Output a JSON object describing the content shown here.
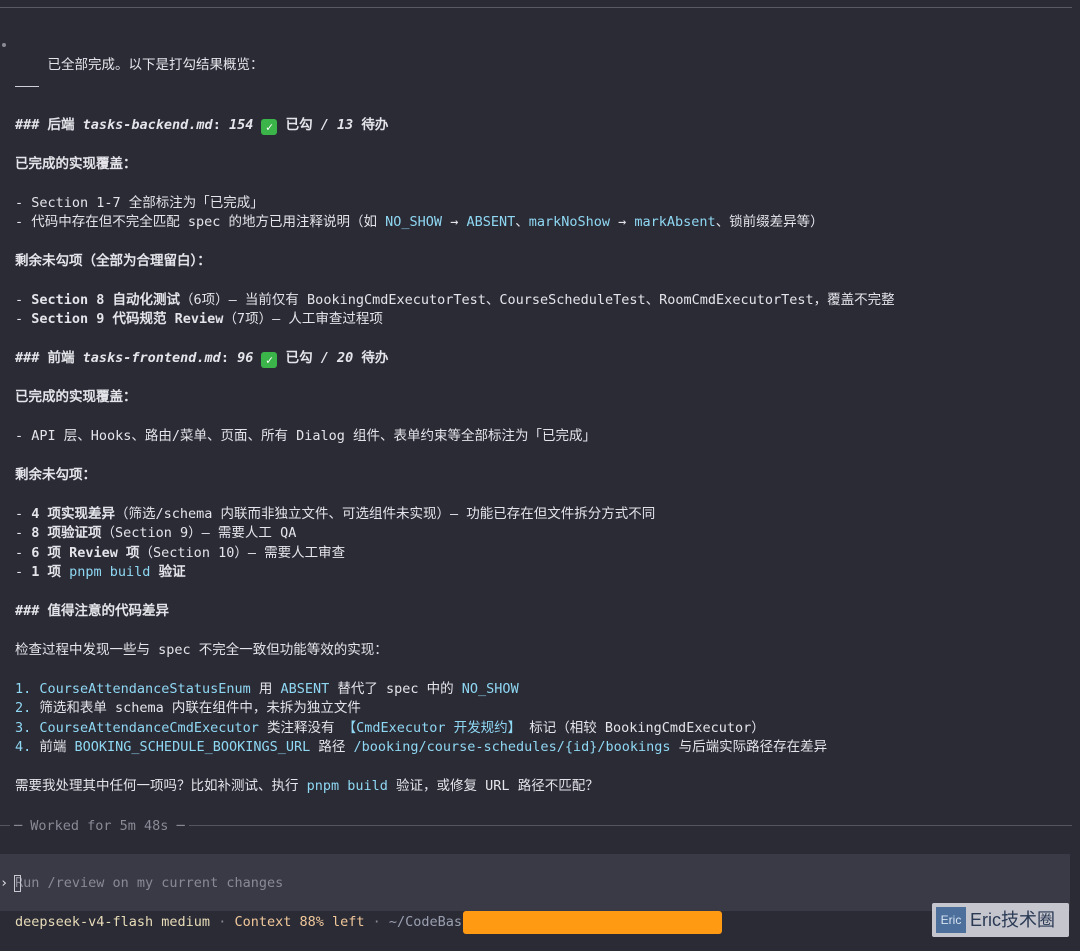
{
  "message": {
    "intro": "已全部完成。以下是打勾结果概览：",
    "backend_heading": {
      "prefix": "### 后端 ",
      "file": "tasks-backend.md",
      "colon": ": ",
      "done": "154",
      "done_label": " 已勾 ",
      "slash": "/ 13",
      "todo_label": " 待办"
    },
    "backend_done_title": "已完成的实现覆盖：",
    "backend_done_items": [
      "- Section 1-7 全部标注为「已完成」"
    ],
    "backend_note": {
      "pre": "- 代码中存在但不完全匹配 spec 的地方已用注释说明（如 ",
      "c1": "NO_SHOW",
      "arrow1": " → ",
      "c2": "ABSENT",
      "mid": "、",
      "c3": "markNoShow",
      "arrow2": " → ",
      "c4": "markAbsent",
      "post": "、锁前缀差异等）"
    },
    "backend_remain_title": "剩余未勾项（全部为合理留白）：",
    "backend_remain": [
      {
        "dash": "- ",
        "bold": "Section 8 自动化测试",
        "rest": "（6项）— 当前仅有 BookingCmdExecutorTest、CourseScheduleTest、RoomCmdExecutorTest，覆盖不完整"
      },
      {
        "dash": "- ",
        "bold": "Section 9 代码规范 Review",
        "rest": "（7项）— 人工审查过程项"
      }
    ],
    "frontend_heading": {
      "prefix": "### 前端 ",
      "file": "tasks-frontend.md",
      "colon": ": ",
      "done": "96",
      "done_label": " 已勾 ",
      "slash": "/ 20",
      "todo_label": " 待办"
    },
    "frontend_done_title": "已完成的实现覆盖：",
    "frontend_done_item": "- API 层、Hooks、路由/菜单、页面、所有 Dialog 组件、表单约束等全部标注为「已完成」",
    "frontend_remain_title": "剩余未勾项：",
    "frontend_remain": [
      {
        "dash": "- ",
        "bold": "4 项实现差异",
        "rest": "（筛选/schema 内联而非独立文件、可选组件未实现）— 功能已存在但文件拆分方式不同"
      },
      {
        "dash": "- ",
        "bold": "8 项验证项",
        "rest": "（Section 9）— 需要人工 QA"
      },
      {
        "dash": "- ",
        "bold": "6 项 Review 项",
        "rest": "（Section 10）— 需要人工审查"
      }
    ],
    "frontend_build": {
      "dash": "- ",
      "bold1": "1 项 ",
      "code": "pnpm build",
      "bold2": " 验证"
    },
    "diff_heading": "### 值得注意的代码差异",
    "diff_intro": "检查过程中发现一些与 spec 不完全一致但功能等效的实现：",
    "diff1": {
      "num": "1. ",
      "c1": "CourseAttendanceStatusEnum",
      "t1": " 用 ",
      "c2": "ABSENT",
      "t2": " 替代了 spec 中的 ",
      "c3": "NO_SHOW"
    },
    "diff2": {
      "num": "2. ",
      "text": "筛选和表单 schema 内联在组件中，未拆为独立文件"
    },
    "diff3": {
      "num": "3. ",
      "c1": "CourseAttendanceCmdExecutor",
      "t1": " 类注释没有 ",
      "c2": "【CmdExecutor 开发规约】",
      "t2": " 标记（相较 BookingCmdExecutor）"
    },
    "diff4": {
      "num": "4. ",
      "t0": "前端 ",
      "c1": "BOOKING_SCHEDULE_BOOKINGS_URL",
      "t1": " 路径 ",
      "c2": "/booking/course-schedules/{id}/bookings",
      "t2": " 与后端实际路径存在差异"
    },
    "question": {
      "t0": "需要我处理其中任何一项吗？比如补测试、执行 ",
      "code": "pnpm build",
      "t1": " 验证，或修复 URL 路径不匹配？"
    }
  },
  "worked": "─ Worked for 5m 48s ─",
  "input": {
    "prompt": "›",
    "placeholder": "Run /review on my current changes"
  },
  "status": {
    "model": "deepseek-v4-flash medium",
    "sep": " · ",
    "context": "Context 88% left",
    "path": "~/CodeBas"
  },
  "watermark": {
    "logo": "Eric",
    "text": "Eric技术圈"
  },
  "colors": {
    "background": "#2b2b36",
    "code": "#8fd8f3",
    "check": "#3bb54a",
    "redaction": "#ff9a12"
  }
}
